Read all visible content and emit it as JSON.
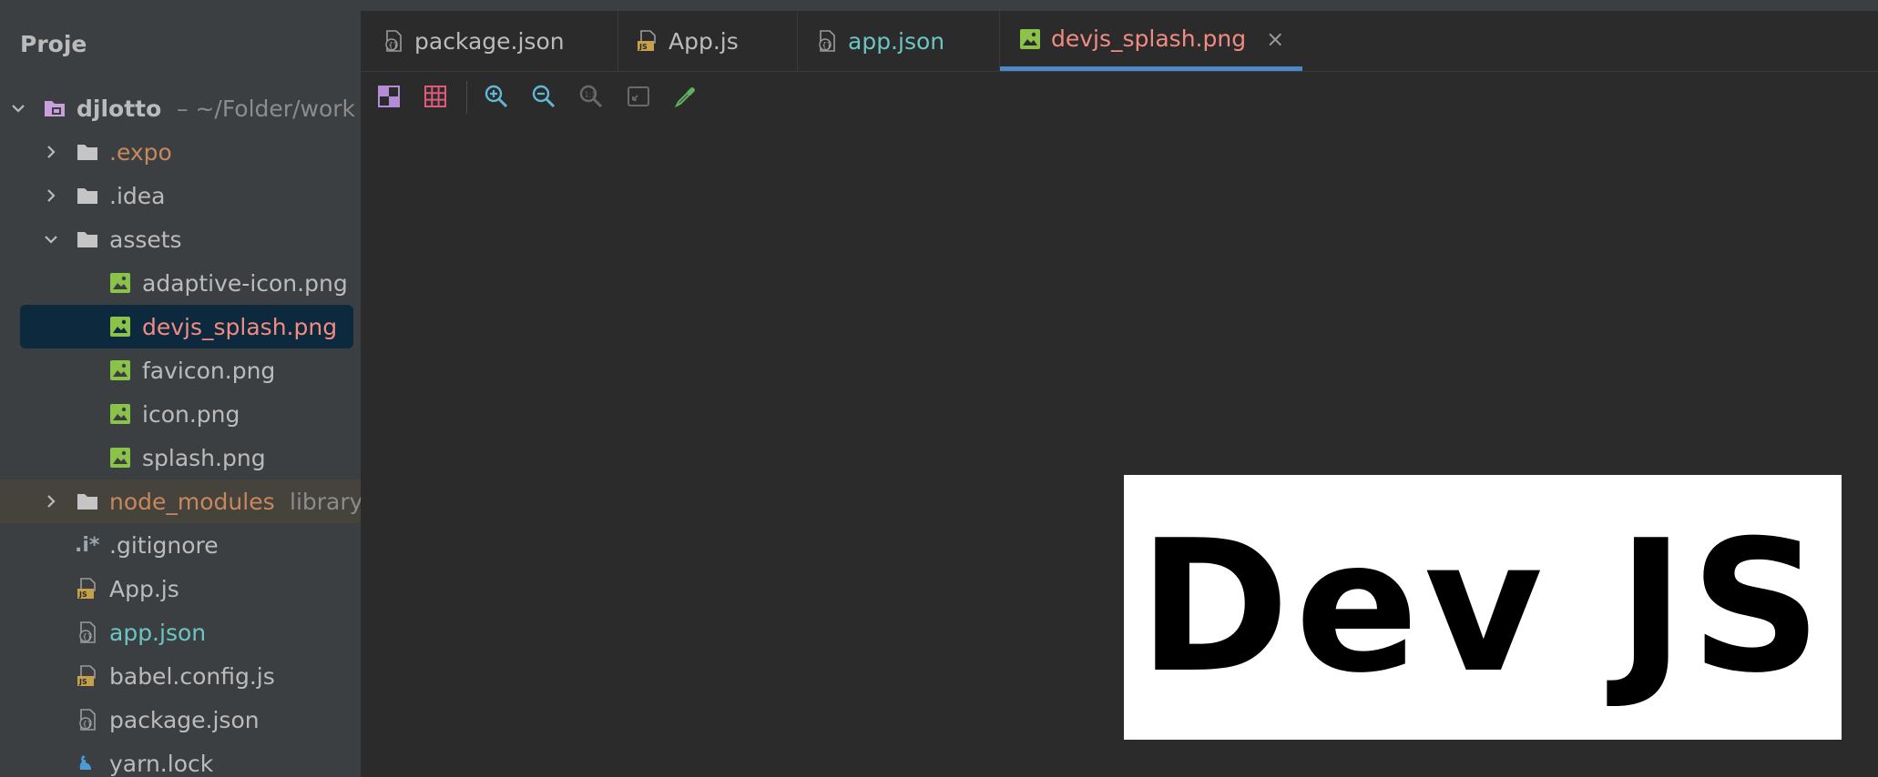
{
  "sidebar": {
    "header": "Project",
    "root": {
      "name": "djlotto",
      "path": "– ~/Folder/work"
    },
    "items": [
      {
        "label": ".expo"
      },
      {
        "label": ".idea"
      },
      {
        "label": "assets"
      },
      {
        "label": "adaptive-icon.png"
      },
      {
        "label": "devjs_splash.png"
      },
      {
        "label": "favicon.png"
      },
      {
        "label": "icon.png"
      },
      {
        "label": "splash.png"
      },
      {
        "label": "node_modules",
        "suffix": "library"
      },
      {
        "label": ".gitignore",
        "icon_text": ".i*"
      },
      {
        "label": "App.js"
      },
      {
        "label": "app.json"
      },
      {
        "label": "babel.config.js"
      },
      {
        "label": "package.json"
      },
      {
        "label": "yarn.lock"
      }
    ]
  },
  "tabs": [
    {
      "label": "package.json",
      "icon": "json-file-icon"
    },
    {
      "label": "App.js",
      "icon": "js-file-icon"
    },
    {
      "label": "app.json",
      "icon": "json-file-icon"
    },
    {
      "label": "devjs_splash.png",
      "icon": "image-file-icon",
      "active": true,
      "close": "×"
    }
  ],
  "toolbar": {
    "buttons": [
      "chessboard-icon",
      "grid-icon",
      "zoom-in-icon",
      "zoom-out-icon",
      "actual-size-icon",
      "fit-to-window-icon",
      "color-picker-icon"
    ]
  },
  "preview": {
    "text": "Dev JS"
  },
  "colors": {
    "selection": "#0d293e",
    "active_tab_underline": "#4a88c7",
    "image_icon": "#8bc34a",
    "modified_red": "#f28b82",
    "cyan_label": "#6cc5c5",
    "excluded_orange": "#c7875f"
  }
}
